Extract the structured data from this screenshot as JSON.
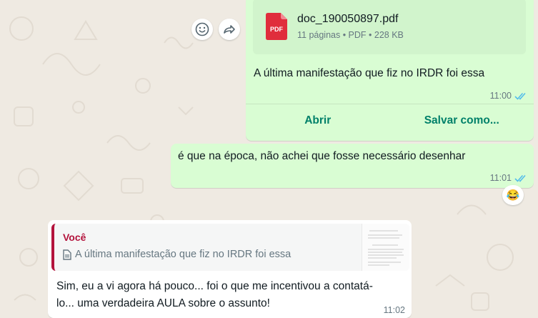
{
  "colors": {
    "chat_bg": "#efeae2",
    "outgoing_bubble": "#d9fdd3",
    "incoming_bubble": "#ffffff",
    "accent_green": "#008069",
    "read_ticks": "#53bdeb",
    "quote_author": "#b3133c",
    "pdf_red": "#e02d3c"
  },
  "message_1": {
    "document": {
      "icon": "pdf-icon",
      "icon_label": "PDF",
      "file_name": "doc_190050897.pdf",
      "meta": "11 páginas • PDF • 228 KB"
    },
    "caption": "A última manifestação que fiz no IRDR foi essa",
    "time": "11:00",
    "status_icon": "double-check-read-icon",
    "actions": {
      "open": "Abrir",
      "save_as": "Salvar como..."
    },
    "hover_buttons": [
      "emoji-icon",
      "forward-icon"
    ]
  },
  "message_2": {
    "text": "é que na época, não achei que fosse necessário desenhar",
    "time": "11:01",
    "status_icon": "double-check-read-icon",
    "reaction": "😂"
  },
  "message_3": {
    "quote": {
      "author": "Você",
      "icon": "document-icon",
      "text": "A última manifestação que fiz no IRDR foi essa"
    },
    "text_line1": "Sim, eu a vi agora há pouco... foi o que me incentivou a contatá-",
    "text_line2": "lo... uma verdadeira AULA sobre o assunto!",
    "time": "11:02"
  }
}
